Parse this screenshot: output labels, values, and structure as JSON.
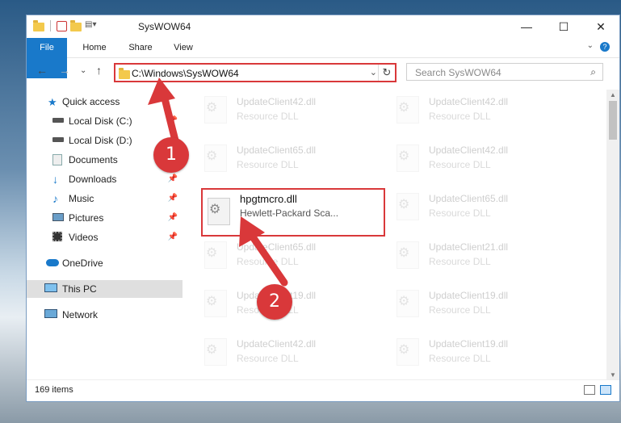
{
  "window": {
    "title": "SysWOW64",
    "controls": {
      "minimize": "—",
      "maximize": "☐",
      "close": "✕"
    }
  },
  "ribbon": {
    "tabs": [
      "File",
      "Home",
      "Share",
      "View"
    ],
    "help_icon": "?",
    "chevron": "⌄"
  },
  "navigation": {
    "back": "←",
    "forward": "→",
    "recent": "⌄",
    "up": "↑",
    "address": "C:\\Windows\\SysWOW64",
    "search_placeholder": "Search SysWOW64"
  },
  "sidebar": {
    "items": [
      {
        "label": "Quick access",
        "icon": "star-icon",
        "pin": ""
      },
      {
        "label": "Local Disk (C:)",
        "icon": "drive-icon",
        "pin": "📌"
      },
      {
        "label": "Local Disk (D:)",
        "icon": "drive-icon",
        "pin": ""
      },
      {
        "label": "Documents",
        "icon": "documents-icon",
        "pin": "📌"
      },
      {
        "label": "Downloads",
        "icon": "download-icon",
        "pin": "📌"
      },
      {
        "label": "Music",
        "icon": "music-icon",
        "pin": "📌"
      },
      {
        "label": "Pictures",
        "icon": "pictures-icon",
        "pin": "📌"
      },
      {
        "label": "Videos",
        "icon": "videos-icon",
        "pin": "📌"
      },
      {
        "label": "OneDrive",
        "icon": "cloud-icon",
        "pin": ""
      },
      {
        "label": "This PC",
        "icon": "computer-icon",
        "pin": ""
      },
      {
        "label": "Network",
        "icon": "network-icon",
        "pin": ""
      }
    ]
  },
  "files": [
    {
      "name": "UpdateClient42.dll",
      "desc": "Resource DLL"
    },
    {
      "name": "UpdateClient42.dll",
      "desc": "Resource DLL"
    },
    {
      "name": "UpdateClient65.dll",
      "desc": "Resource DLL"
    },
    {
      "name": "UpdateClient42.dll",
      "desc": "Resource DLL"
    },
    {
      "name": "hpgtmcro.dll",
      "desc": "Hewlett-Packard Sca..."
    },
    {
      "name": "UpdateClient65.dll",
      "desc": "Resource DLL"
    },
    {
      "name": "UpdateClient65.dll",
      "desc": "Resource DLL"
    },
    {
      "name": "UpdateClient21.dll",
      "desc": "Resource DLL"
    },
    {
      "name": "UpdateClient19.dll",
      "desc": "Resource DLL"
    },
    {
      "name": "UpdateClient19.dll",
      "desc": "Resource DLL"
    },
    {
      "name": "UpdateClient42.dll",
      "desc": "Resource DLL"
    },
    {
      "name": "UpdateClient19.dll",
      "desc": "Resource DLL"
    }
  ],
  "status": {
    "count": "169 items"
  },
  "annotations": {
    "step1": "1",
    "step2": "2"
  },
  "colors": {
    "accent": "#1979ca",
    "highlight": "#d9383a"
  }
}
